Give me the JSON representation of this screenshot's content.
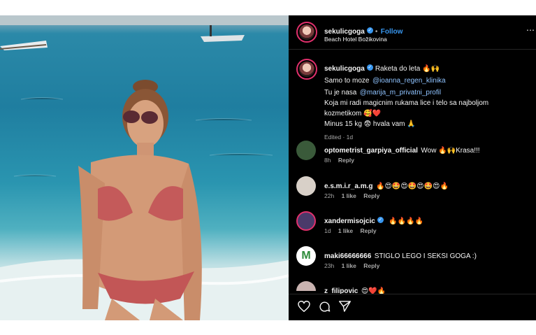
{
  "header": {
    "username": "sekulicgoga",
    "follow_separator": "•",
    "follow_label": "Follow",
    "location": "Beach Hotel Božikovina"
  },
  "caption": {
    "username": "sekulicgoga",
    "lines": [
      "Raketa do leta 🔥🙌",
      "Samo to moze",
      "Tu je nasa",
      "Koja mi radi magicnim rukama lice i telo sa najboljom",
      "kozmetikom 🥰❤️",
      "Minus 15 kg 😨 hvala vam 🙏"
    ],
    "mention1": "@ioanna_regen_klinika",
    "mention2": "@marija_m_privatni_profil",
    "meta": "Edited · 1d"
  },
  "comments": [
    {
      "username": "optometrist_garpiya_official",
      "text": "Wow 🔥🙌Krasa!!!",
      "time": "8h",
      "likes": "",
      "reply": "Reply",
      "avatar_color": "#3a5a3a"
    },
    {
      "username": "e.s.m.i.r_a.m.g",
      "text": "🔥😍🤩😍🤩😍🤩😍🔥",
      "time": "22h",
      "likes": "1 like",
      "reply": "Reply",
      "avatar_color": "#d8d0c8"
    },
    {
      "username": "xandermisojcic",
      "text": "🔥🔥🔥🔥",
      "time": "1d",
      "likes": "1 like",
      "reply": "Reply",
      "avatar_color": "#4a3a6a"
    },
    {
      "username": "maki66666666",
      "text": "STIGLO LEGO I SEKSI GOGA :)",
      "time": "23h",
      "likes": "1 like",
      "reply": "Reply",
      "avatar_color": "#ffffff",
      "avatar_letter": "M"
    },
    {
      "username": "z_filipovic",
      "text": "😍❤️🔥",
      "time": "",
      "likes": "",
      "reply": "",
      "avatar_color": "#c9b3b0"
    }
  ],
  "actions": {
    "like": "heart-icon",
    "comment": "comment-icon",
    "share": "share-icon"
  },
  "colors": {
    "accent": "#3897f0",
    "ring": "#e1306c",
    "panel_bg": "#000000"
  }
}
